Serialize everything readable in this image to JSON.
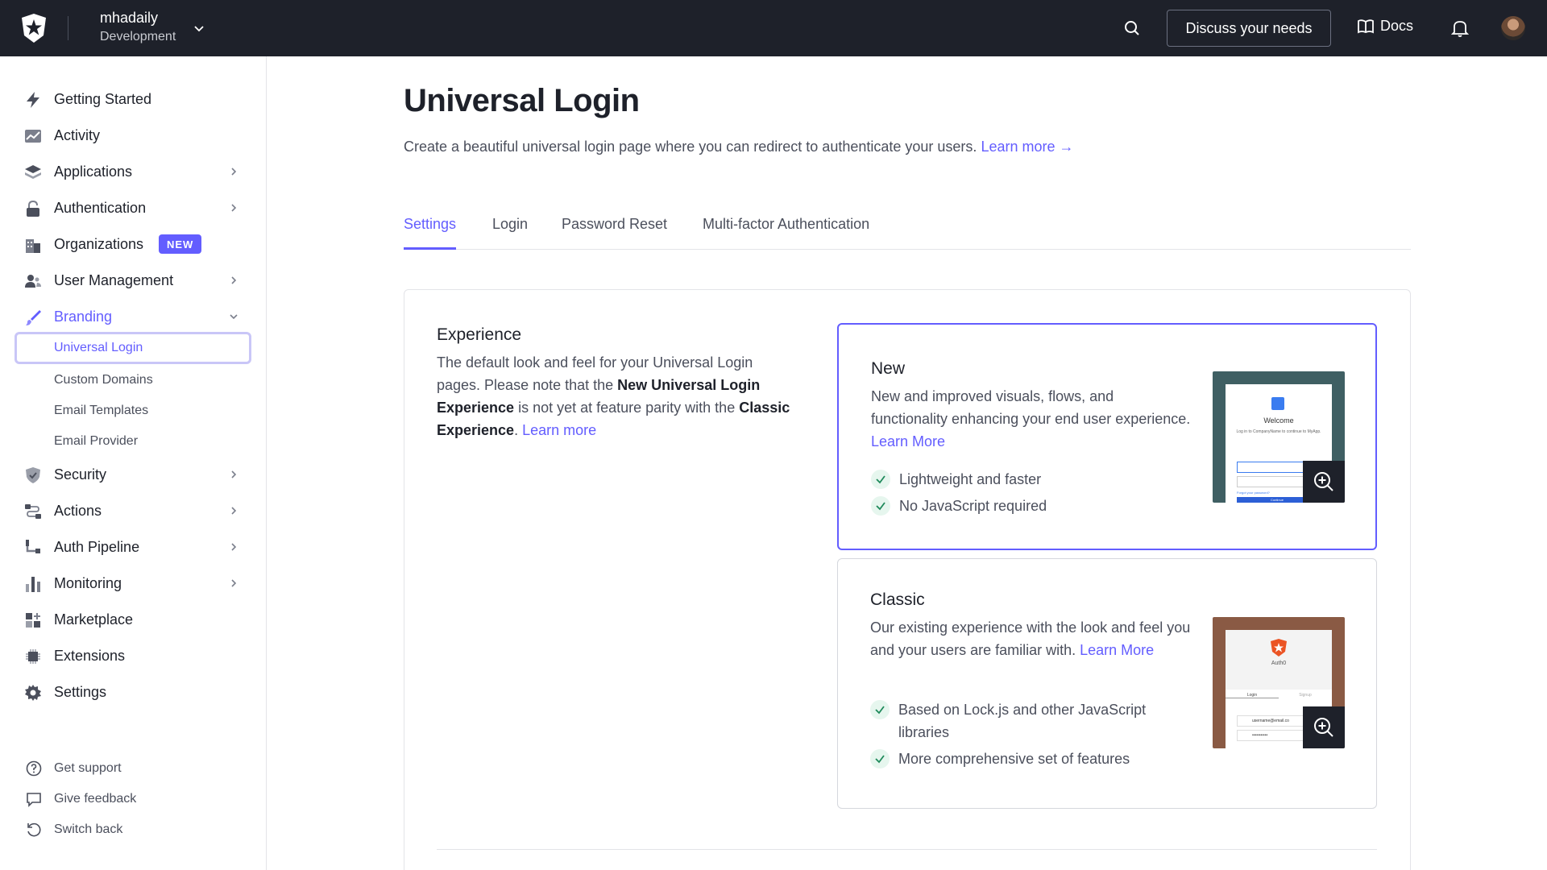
{
  "topbar": {
    "tenant_name": "mhadaily",
    "tenant_env": "Development",
    "discuss_label": "Discuss your needs",
    "docs_label": "Docs"
  },
  "sidebar": {
    "items": [
      {
        "label": "Getting Started",
        "icon": "lightning-icon"
      },
      {
        "label": "Activity",
        "icon": "activity-chart-icon"
      },
      {
        "label": "Applications",
        "icon": "layers-icon"
      },
      {
        "label": "Authentication",
        "icon": "lock-icon"
      },
      {
        "label": "Organizations",
        "icon": "building-icon",
        "badge": "NEW"
      },
      {
        "label": "User Management",
        "icon": "users-icon"
      },
      {
        "label": "Branding",
        "icon": "brush-icon"
      },
      {
        "label": "Security",
        "icon": "shield-icon"
      },
      {
        "label": "Actions",
        "icon": "flow-icon"
      },
      {
        "label": "Auth Pipeline",
        "icon": "pipeline-icon"
      },
      {
        "label": "Monitoring",
        "icon": "bar-chart-icon"
      },
      {
        "label": "Marketplace",
        "icon": "grid-plus-icon"
      },
      {
        "label": "Extensions",
        "icon": "chip-icon"
      },
      {
        "label": "Settings",
        "icon": "gear-icon"
      }
    ],
    "branding_sub": [
      {
        "label": "Universal Login"
      },
      {
        "label": "Custom Domains"
      },
      {
        "label": "Email Templates"
      },
      {
        "label": "Email Provider"
      }
    ],
    "footer": [
      {
        "label": "Get support"
      },
      {
        "label": "Give feedback"
      },
      {
        "label": "Switch back"
      }
    ]
  },
  "main": {
    "title": "Universal Login",
    "description": "Create a beautiful universal login page where you can redirect to authenticate your users.",
    "learn_more": "Learn more →",
    "tabs": [
      {
        "label": "Settings"
      },
      {
        "label": "Login"
      },
      {
        "label": "Password Reset"
      },
      {
        "label": "Multi-factor Authentication"
      }
    ],
    "experience": {
      "title": "Experience",
      "text_1": "The default look and feel for your Universal Login pages. Please note that the ",
      "bold_1": "New Universal Login Experience",
      "text_2": " is not yet at feature parity with the ",
      "bold_2": "Classic Experience",
      "text_3": ". ",
      "link": "Learn more"
    },
    "options": {
      "new": {
        "title": "New",
        "desc": "New and improved visuals, flows, and functionality enhancing your end user experience. ",
        "link": "Learn More",
        "features": [
          "Lightweight and faster",
          "No JavaScript required"
        ],
        "preview": {
          "welcome": "Welcome",
          "line": "Log in to CompanyName to continue to MyApp.",
          "forgot": "Forgot your password?",
          "button": "Continue"
        }
      },
      "classic": {
        "title": "Classic",
        "desc": "Our existing experience with the look and feel you and your users are familiar with. ",
        "link": "Learn More",
        "features": [
          "Based on Lock.js and other JavaScript libraries",
          "More comprehensive set of features"
        ],
        "preview": {
          "brand": "Auth0",
          "tab_login": "Login",
          "tab_signup": "Signup",
          "email": "username@email.co",
          "password": "•••••••••••"
        }
      }
    }
  },
  "colors": {
    "accent": "#635dff",
    "topbar": "#1e212a",
    "check_bg": "#e6f6ee",
    "check": "#1f8a5b"
  }
}
